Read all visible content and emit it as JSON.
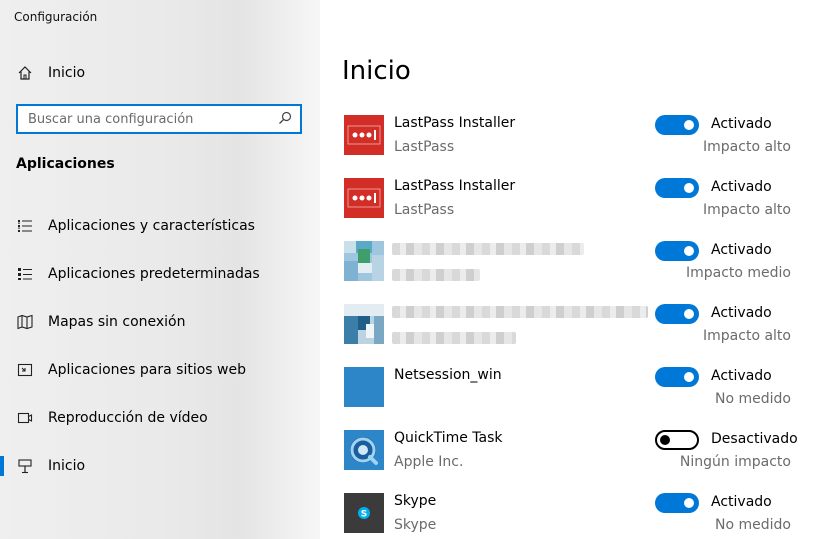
{
  "window": {
    "title": "Configuración"
  },
  "sidebar": {
    "home_label": "Inicio",
    "search_placeholder": "Buscar una configuración",
    "section_title": "Aplicaciones",
    "items": [
      {
        "label": "Aplicaciones y características",
        "icon": "list-icon",
        "active": false
      },
      {
        "label": "Aplicaciones predeterminadas",
        "icon": "default-apps-icon",
        "active": false
      },
      {
        "label": "Mapas sin conexión",
        "icon": "map-icon",
        "active": false
      },
      {
        "label": "Aplicaciones para sitios web",
        "icon": "web-apps-icon",
        "active": false
      },
      {
        "label": "Reproducción de vídeo",
        "icon": "video-icon",
        "active": false
      },
      {
        "label": "Inicio",
        "icon": "startup-icon",
        "active": true
      }
    ]
  },
  "main": {
    "title": "Inicio",
    "apps": [
      {
        "name": "LastPass Installer",
        "publisher": "LastPass",
        "state": "Activado",
        "on": true,
        "impact": "Impacto alto",
        "icon": "lastpass-icon"
      },
      {
        "name": "LastPass Installer",
        "publisher": "LastPass",
        "state": "Activado",
        "on": true,
        "impact": "Impacto alto",
        "icon": "lastpass-icon"
      },
      {
        "name": "",
        "publisher": "",
        "state": "Activado",
        "on": true,
        "impact": "Impacto medio",
        "icon": "blurred-app-icon"
      },
      {
        "name": "",
        "publisher": "",
        "state": "Activado",
        "on": true,
        "impact": "Impacto alto",
        "icon": "blurred-app-icon"
      },
      {
        "name": "Netsession_win",
        "publisher": "",
        "state": "Activado",
        "on": true,
        "impact": "No medido",
        "icon": "blank-app-icon"
      },
      {
        "name": "QuickTime Task",
        "publisher": "Apple Inc.",
        "state": "Desactivado",
        "on": false,
        "impact": "Ningún impacto",
        "icon": "quicktime-icon"
      },
      {
        "name": "Skype",
        "publisher": "Skype",
        "state": "Activado",
        "on": true,
        "impact": "No medido",
        "icon": "skype-icon"
      }
    ]
  },
  "colors": {
    "accent": "#0078d7",
    "lastpass_red": "#d32d27",
    "app_blue": "#2d86c8",
    "skype_bg": "#3b3b3b"
  }
}
